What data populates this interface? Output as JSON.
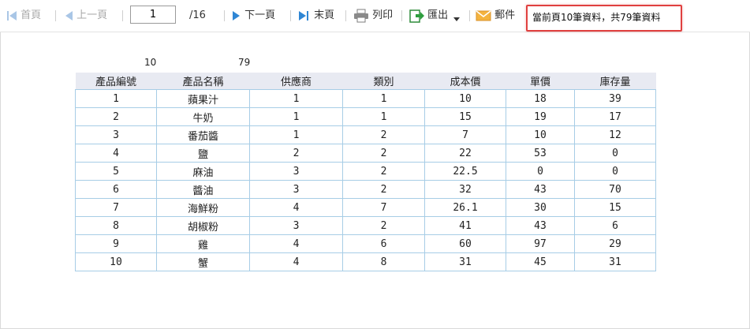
{
  "toolbar": {
    "first_label": "首頁",
    "prev_label": "上一頁",
    "page_value": "1",
    "page_total": "/16",
    "next_label": "下一頁",
    "last_label": "末頁",
    "print_label": "列印",
    "export_label": "匯出",
    "mail_label": "郵件",
    "status_text": "當前頁10筆資料，共79筆資料",
    "icons": {
      "first": "first-page-icon",
      "prev": "prev-page-icon",
      "next": "next-page-icon",
      "last": "last-page-icon",
      "print": "printer-icon",
      "export": "export-icon",
      "mail": "mail-icon"
    }
  },
  "summary": {
    "page_count": "10",
    "total_count": "79"
  },
  "colors": {
    "accent_blue": "#2f86d4",
    "status_border": "#e0403f",
    "header_bg": "#e8eaf2",
    "grid_border": "#a7cde6"
  },
  "table": {
    "headers": [
      "產品編號",
      "產品名稱",
      "供應商",
      "類別",
      "成本價",
      "單價",
      "庫存量"
    ],
    "rows": [
      [
        "1",
        "蘋果汁",
        "1",
        "1",
        "10",
        "18",
        "39"
      ],
      [
        "2",
        "牛奶",
        "1",
        "1",
        "15",
        "19",
        "17"
      ],
      [
        "3",
        "番茄醬",
        "1",
        "2",
        "7",
        "10",
        "12"
      ],
      [
        "4",
        "鹽",
        "2",
        "2",
        "22",
        "53",
        "0"
      ],
      [
        "5",
        "麻油",
        "3",
        "2",
        "22.5",
        "0",
        "0"
      ],
      [
        "6",
        "醬油",
        "3",
        "2",
        "32",
        "43",
        "70"
      ],
      [
        "7",
        "海鮮粉",
        "4",
        "7",
        "26.1",
        "30",
        "15"
      ],
      [
        "8",
        "胡椒粉",
        "3",
        "2",
        "41",
        "43",
        "6"
      ],
      [
        "9",
        "雞",
        "4",
        "6",
        "60",
        "97",
        "29"
      ],
      [
        "10",
        "蟹",
        "4",
        "8",
        "31",
        "45",
        "31"
      ]
    ]
  }
}
